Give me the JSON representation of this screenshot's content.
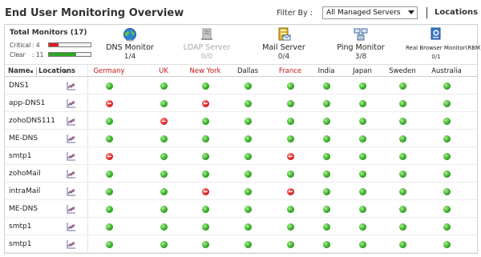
{
  "header": {
    "title": "End User Monitoring Overview",
    "filter_label": "Filter By :",
    "filter_value": "All Managed Servers",
    "locations_link": "Locations"
  },
  "summary": {
    "title": "Total Monitors (17)",
    "critical_label": "Critical",
    "critical_count": ": 4",
    "clear_label": "Clear",
    "clear_count": ": 11",
    "critical_fraction": 0.24,
    "clear_fraction": 0.65,
    "colors": {
      "critical": "#dd2020",
      "clear": "#2fa621"
    }
  },
  "monitor_types": [
    {
      "name": "DNS Monitor",
      "count": "1/4",
      "icon": "globe-icon",
      "enabled": true
    },
    {
      "name": "LDAP Server",
      "count": "0/0",
      "icon": "server-icon",
      "enabled": false
    },
    {
      "name": "Mail Server",
      "count": "0/4",
      "icon": "mail-server-icon",
      "enabled": true
    },
    {
      "name": "Ping Monitor",
      "count": "3/8",
      "icon": "ping-network-icon",
      "enabled": true
    },
    {
      "name": "Real Browser Monitor(RBM)",
      "count": "0/1",
      "icon": "browser-monitor-icon",
      "enabled": true
    }
  ],
  "table": {
    "name_header": "Name",
    "locations_header": "Locations",
    "locations": [
      {
        "name": "Germany",
        "alert": true
      },
      {
        "name": "UK",
        "alert": true
      },
      {
        "name": "New York",
        "alert": true
      },
      {
        "name": "Dallas",
        "alert": false
      },
      {
        "name": "France",
        "alert": true
      },
      {
        "name": "India",
        "alert": false
      },
      {
        "name": "Japan",
        "alert": false
      },
      {
        "name": "Sweden",
        "alert": false
      },
      {
        "name": "Australia",
        "alert": false
      }
    ],
    "rows": [
      {
        "name": "DNS1",
        "statuses": [
          "up",
          "up",
          "up",
          "up",
          "up",
          "up",
          "up",
          "up",
          "up"
        ]
      },
      {
        "name": "app-DNS1",
        "statuses": [
          "down",
          "up",
          "down",
          "up",
          "up",
          "up",
          "up",
          "up",
          "up"
        ]
      },
      {
        "name": "zohoDNS111",
        "statuses": [
          "up",
          "down",
          "up",
          "up",
          "up",
          "up",
          "up",
          "up",
          "up"
        ]
      },
      {
        "name": "ME-DNS",
        "statuses": [
          "up",
          "up",
          "up",
          "up",
          "up",
          "up",
          "up",
          "up",
          "up"
        ]
      },
      {
        "name": "smtp1",
        "statuses": [
          "down",
          "up",
          "up",
          "up",
          "down",
          "up",
          "up",
          "up",
          "up"
        ]
      },
      {
        "name": "zohoMail",
        "statuses": [
          "up",
          "up",
          "up",
          "up",
          "up",
          "up",
          "up",
          "up",
          "up"
        ]
      },
      {
        "name": "intraMail",
        "statuses": [
          "up",
          "up",
          "down",
          "up",
          "down",
          "up",
          "up",
          "up",
          "up"
        ]
      },
      {
        "name": "ME-DNS",
        "statuses": [
          "up",
          "up",
          "up",
          "up",
          "up",
          "up",
          "up",
          "up",
          "up"
        ]
      },
      {
        "name": "smtp1",
        "statuses": [
          "up",
          "up",
          "up",
          "up",
          "up",
          "up",
          "up",
          "up",
          "up"
        ]
      },
      {
        "name": "smtp1",
        "statuses": [
          "up",
          "up",
          "up",
          "up",
          "up",
          "up",
          "up",
          "up",
          "up"
        ]
      }
    ]
  }
}
